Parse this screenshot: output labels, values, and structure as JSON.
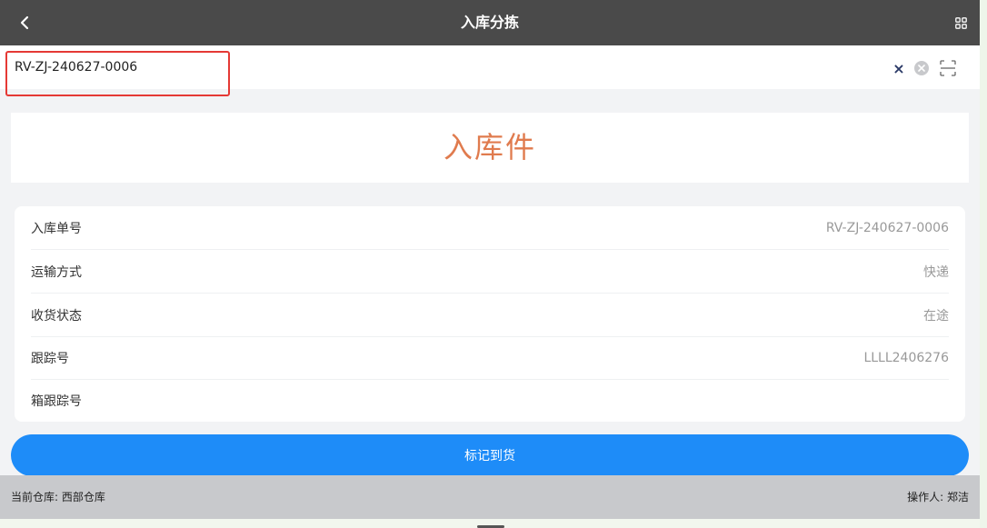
{
  "header": {
    "title": "入库分拣"
  },
  "search": {
    "value": "RV-ZJ-240627-0006",
    "clear_label": "×"
  },
  "banner": {
    "text": "入库件"
  },
  "details": [
    {
      "label": "入库单号",
      "value": "RV-ZJ-240627-0006"
    },
    {
      "label": "运输方式",
      "value": "快递"
    },
    {
      "label": "收货状态",
      "value": "在途"
    },
    {
      "label": "跟踪号",
      "value": "LLLL2406276"
    },
    {
      "label": "箱跟踪号",
      "value": ""
    }
  ],
  "actions": {
    "mark_arrival_label": "标记到货"
  },
  "footer": {
    "warehouse": "当前仓库: 西部仓库",
    "operator": "操作人: 郑洁"
  },
  "colors": {
    "header_bg": "#4a4a4a",
    "banner_text": "#e07b4e",
    "primary": "#1e8cf8",
    "highlight": "#e53935"
  }
}
